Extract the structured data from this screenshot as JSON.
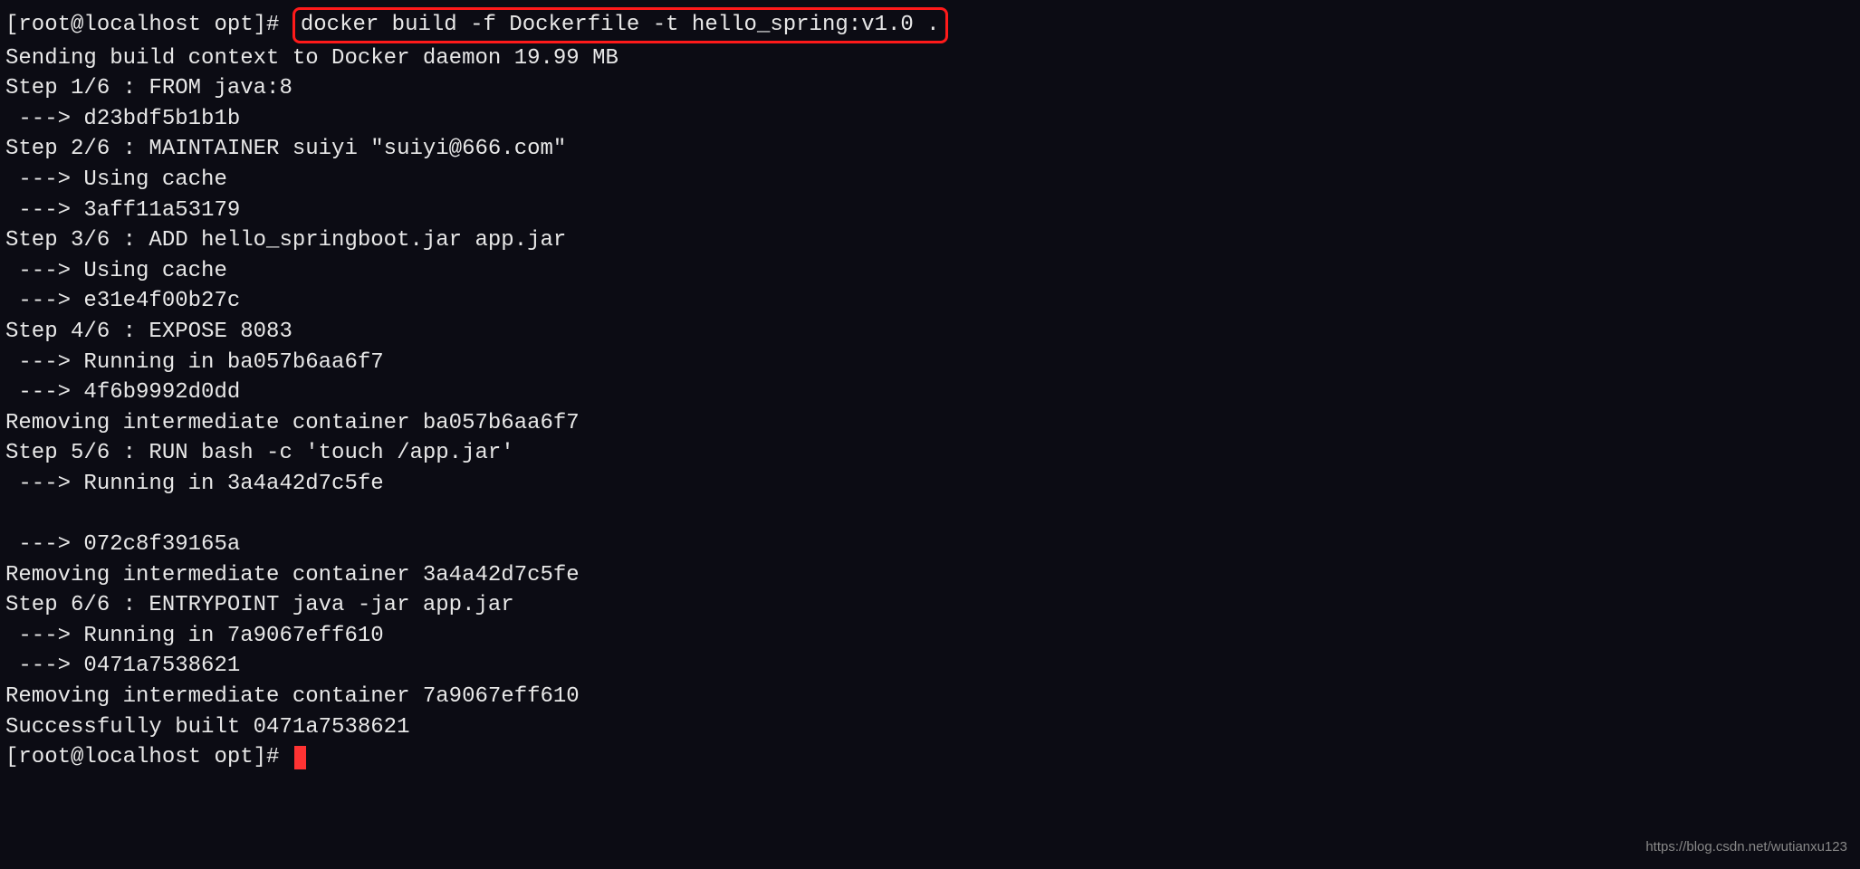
{
  "prompt1_prefix": "[root@localhost opt]# ",
  "highlighted_command": "docker build -f Dockerfile -t hello_spring:v1.0 .",
  "lines": [
    "Sending build context to Docker daemon 19.99 MB",
    "Step 1/6 : FROM java:8",
    " ---> d23bdf5b1b1b",
    "Step 2/6 : MAINTAINER suiyi \"suiyi@666.com\"",
    " ---> Using cache",
    " ---> 3aff11a53179",
    "Step 3/6 : ADD hello_springboot.jar app.jar",
    " ---> Using cache",
    " ---> e31e4f00b27c",
    "Step 4/6 : EXPOSE 8083",
    " ---> Running in ba057b6aa6f7",
    " ---> 4f6b9992d0dd",
    "Removing intermediate container ba057b6aa6f7",
    "Step 5/6 : RUN bash -c 'touch /app.jar'",
    " ---> Running in 3a4a42d7c5fe",
    "",
    " ---> 072c8f39165a",
    "Removing intermediate container 3a4a42d7c5fe",
    "Step 6/6 : ENTRYPOINT java -jar app.jar",
    " ---> Running in 7a9067eff610",
    " ---> 0471a7538621",
    "Removing intermediate container 7a9067eff610",
    "Successfully built 0471a7538621"
  ],
  "prompt2_prefix": "[root@localhost opt]# ",
  "watermark": "https://blog.csdn.net/wutianxu123"
}
